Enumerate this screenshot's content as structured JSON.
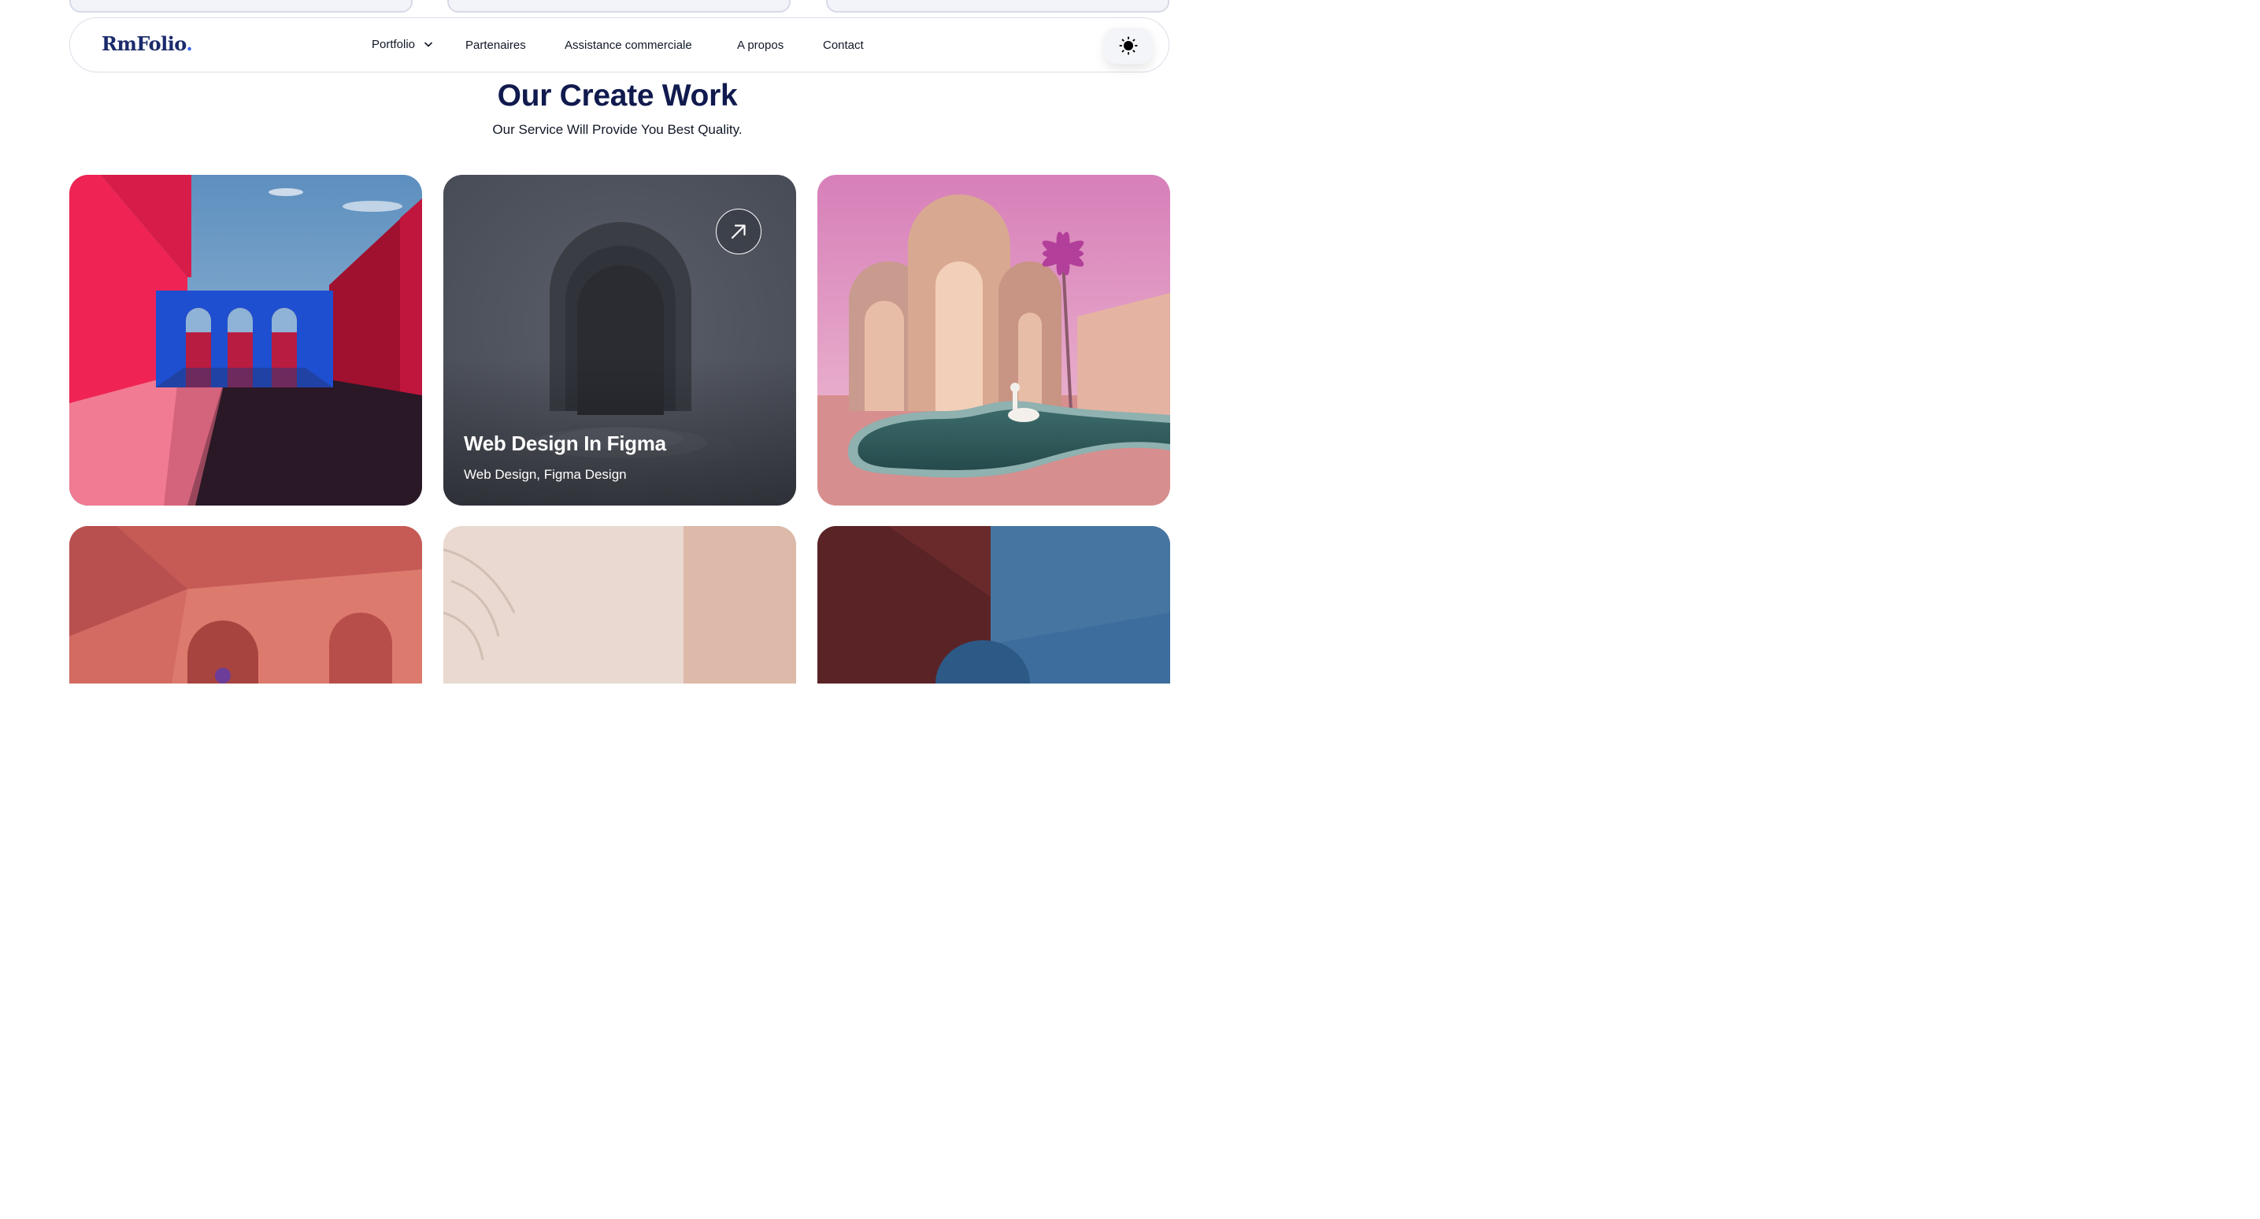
{
  "brand": {
    "logo_text": "RmFolio",
    "logo_dot": "."
  },
  "nav": {
    "items": [
      {
        "label": "Portfolio",
        "has_dropdown": true
      },
      {
        "label": "Partenaires"
      },
      {
        "label": "Assistance commerciale"
      },
      {
        "label": "A propos"
      },
      {
        "label": "Contact"
      }
    ],
    "theme_toggle_icon": "sun-icon"
  },
  "section": {
    "title": "Our Create Work",
    "subtitle": "Our Service Will Provide You Best Quality."
  },
  "cards": [
    {
      "image": "red-courtyard-blue-arches"
    },
    {
      "image": "grey-arch-tunnel",
      "title": "Web Design In Figma",
      "tags": "Web Design, Figma Design",
      "action_icon": "arrow-up-right-icon"
    },
    {
      "image": "pink-arches-pool-palm"
    },
    {
      "image": "coral-room"
    },
    {
      "image": "beige-wall-palm-shadow"
    },
    {
      "image": "maroon-blue-split"
    }
  ],
  "colors": {
    "title": "#101a4e",
    "logo": "#1a2a6b",
    "logo_dot": "#3b63f0"
  }
}
